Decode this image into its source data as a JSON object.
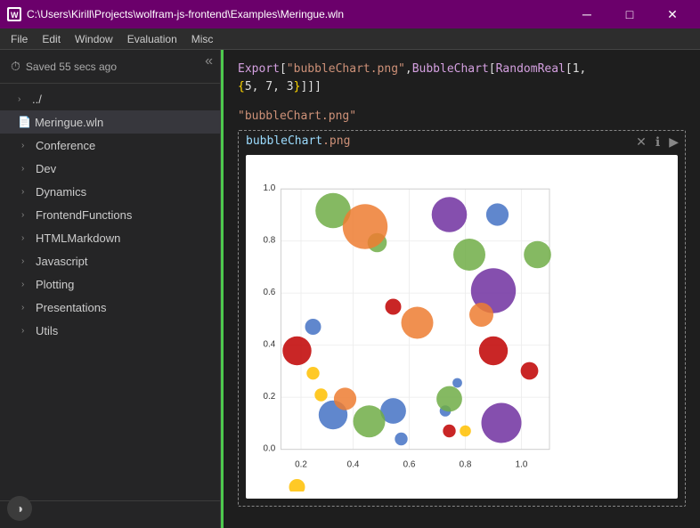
{
  "titlebar": {
    "path": "C:\\Users\\Kirill\\Projects\\wolfram-js-frontend\\Examples\\Meringue.wln",
    "controls": {
      "minimize": "─",
      "maximize": "□",
      "close": "✕"
    }
  },
  "menubar": {
    "items": [
      "File",
      "Edit",
      "Window",
      "Evaluation",
      "Misc"
    ]
  },
  "sidebar": {
    "collapse_icon": "«",
    "saved_text": "Saved 55 secs ago",
    "tree": [
      {
        "type": "parent",
        "label": "../",
        "chevron": "›"
      },
      {
        "type": "file",
        "label": "Meringue.wln",
        "selected": true
      },
      {
        "type": "folder",
        "label": "Conference",
        "chevron": "›"
      },
      {
        "type": "folder",
        "label": "Dev",
        "chevron": "›"
      },
      {
        "type": "folder",
        "label": "Dynamics",
        "chevron": "›"
      },
      {
        "type": "folder",
        "label": "FrontendFunctions",
        "chevron": "›"
      },
      {
        "type": "folder",
        "label": "HTMLMarkdown",
        "chevron": "›"
      },
      {
        "type": "folder",
        "label": "Javascript",
        "chevron": "›"
      },
      {
        "type": "folder",
        "label": "Plotting",
        "chevron": "›"
      },
      {
        "type": "folder",
        "label": "Presentations",
        "chevron": "›"
      },
      {
        "type": "folder",
        "label": "Utils",
        "chevron": "›"
      }
    ],
    "bottom": {
      "add": "+",
      "chevron": "›"
    }
  },
  "code": {
    "line1": "Export[\"bubbleChart.png\",BubbleChart[RandomReal[1,",
    "line2": "{5, 7, 3}]]]",
    "output_string": "\"bubbleChart.png\"",
    "cell_filename_base": "bubbleChart",
    "cell_filename_ext": ".png"
  },
  "cell_actions": {
    "delete": "✕",
    "info": "ℹ",
    "run": "▶"
  },
  "theme": {
    "toggle_icon": "◑"
  }
}
